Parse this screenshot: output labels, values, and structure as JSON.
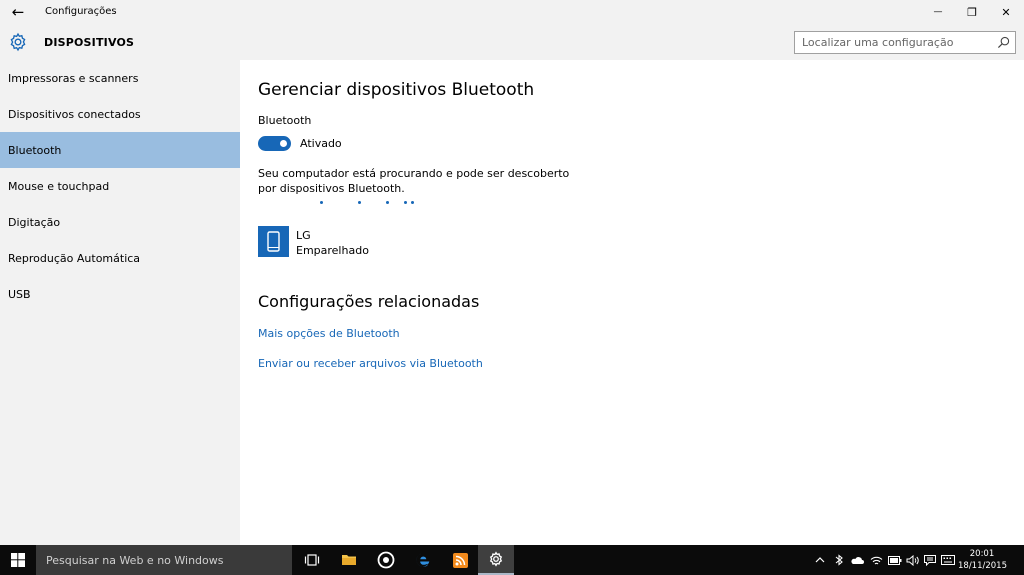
{
  "window": {
    "title": "Configurações",
    "back_glyph": "←",
    "minimize_glyph": "—",
    "restore_glyph": "❐",
    "close_glyph": "✕"
  },
  "header": {
    "icon": "gear-icon",
    "title": "DISPOSITIVOS",
    "search_placeholder": "Localizar uma configuração"
  },
  "sidebar": {
    "selected_index": 2,
    "items": [
      {
        "label": "Impressoras e scanners"
      },
      {
        "label": "Dispositivos conectados"
      },
      {
        "label": "Bluetooth"
      },
      {
        "label": "Mouse e touchpad"
      },
      {
        "label": "Digitação"
      },
      {
        "label": "Reprodução Automática"
      },
      {
        "label": "USB"
      }
    ]
  },
  "main": {
    "heading": "Gerenciar dispositivos Bluetooth",
    "bluetooth_label": "Bluetooth",
    "toggle_state": "Ativado",
    "toggle_on": true,
    "description": "Seu computador está procurando e pode ser descoberto por dispositivos Bluetooth.",
    "devices": [
      {
        "name": "LG",
        "status": "Emparelhado",
        "icon": "phone-icon"
      }
    ],
    "related_heading": "Configurações relacionadas",
    "links": [
      "Mais opções de Bluetooth",
      "Enviar ou receber arquivos via Bluetooth"
    ]
  },
  "taskbar": {
    "search_placeholder": "Pesquisar na Web e no Windows",
    "apps": [
      "task-view-icon",
      "file-explorer-icon",
      "media-player-icon",
      "edge-icon",
      "feed-reader-icon",
      "settings-icon"
    ],
    "tray": [
      "chevron-up-icon",
      "bluetooth-icon",
      "onedrive-icon",
      "network-icon",
      "wifi-icon",
      "battery-icon",
      "volume-icon",
      "notifications-icon",
      "keyboard-icon"
    ],
    "time": "20:01",
    "date": "18/11/2015"
  },
  "colors": {
    "accent": "#1767b7",
    "selected_nav": "#99bde0",
    "chrome": "#f2f2f2",
    "taskbar": "#0b0b0b"
  }
}
